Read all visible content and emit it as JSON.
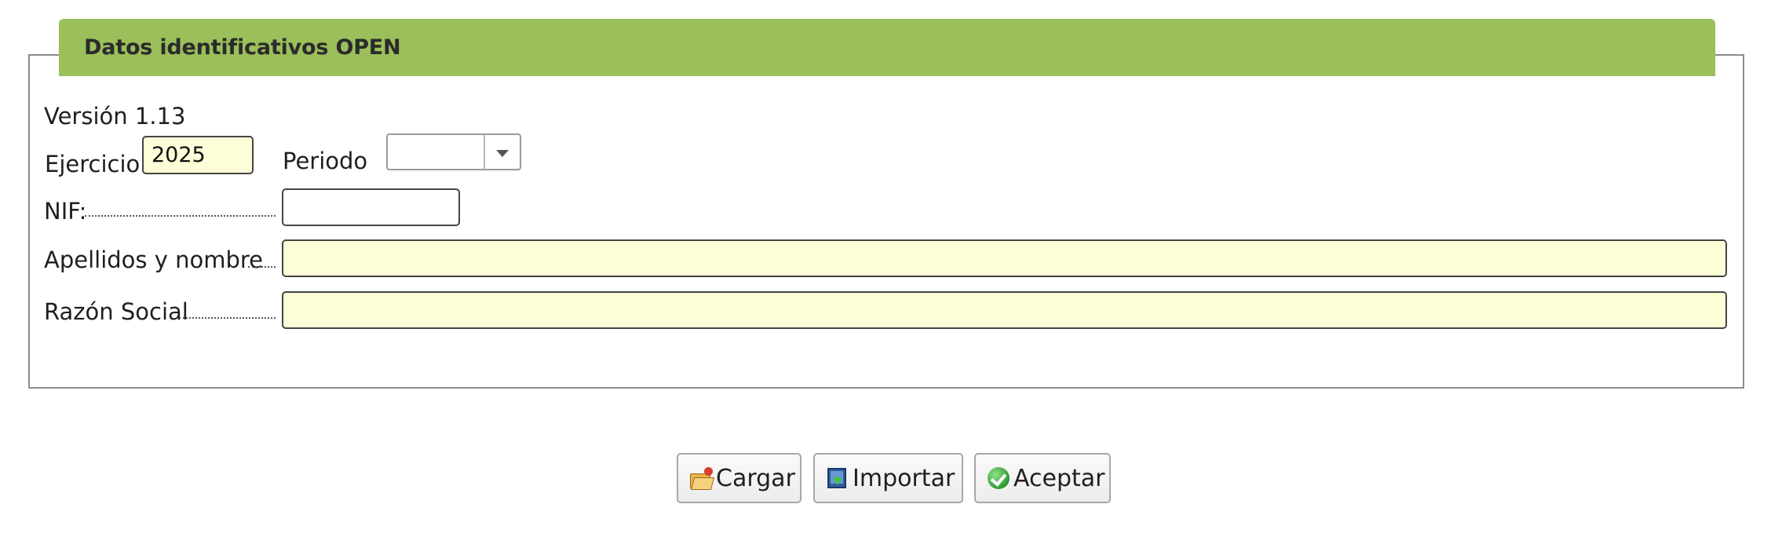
{
  "section": {
    "title": "Datos identificativos OPEN"
  },
  "form": {
    "version_label": "Versión 1.13",
    "ejercicio_label": "Ejercicio",
    "ejercicio_value": "2025",
    "periodo_label": "Periodo",
    "periodo_value": "",
    "nif_label": "NIF:",
    "nif_value": "",
    "apellidos_label": "Apellidos y nombre",
    "apellidos_value": "",
    "razon_label": "Razón Social",
    "razon_value": ""
  },
  "buttons": {
    "cargar": {
      "label": "Cargar",
      "icon": "folder-open-icon"
    },
    "importar": {
      "label": "Importar",
      "icon": "import-icon"
    },
    "aceptar": {
      "label": "Aceptar",
      "icon": "check-icon"
    }
  },
  "colors": {
    "header": "#9bbf5a",
    "input_highlight": "#fdfed8"
  }
}
